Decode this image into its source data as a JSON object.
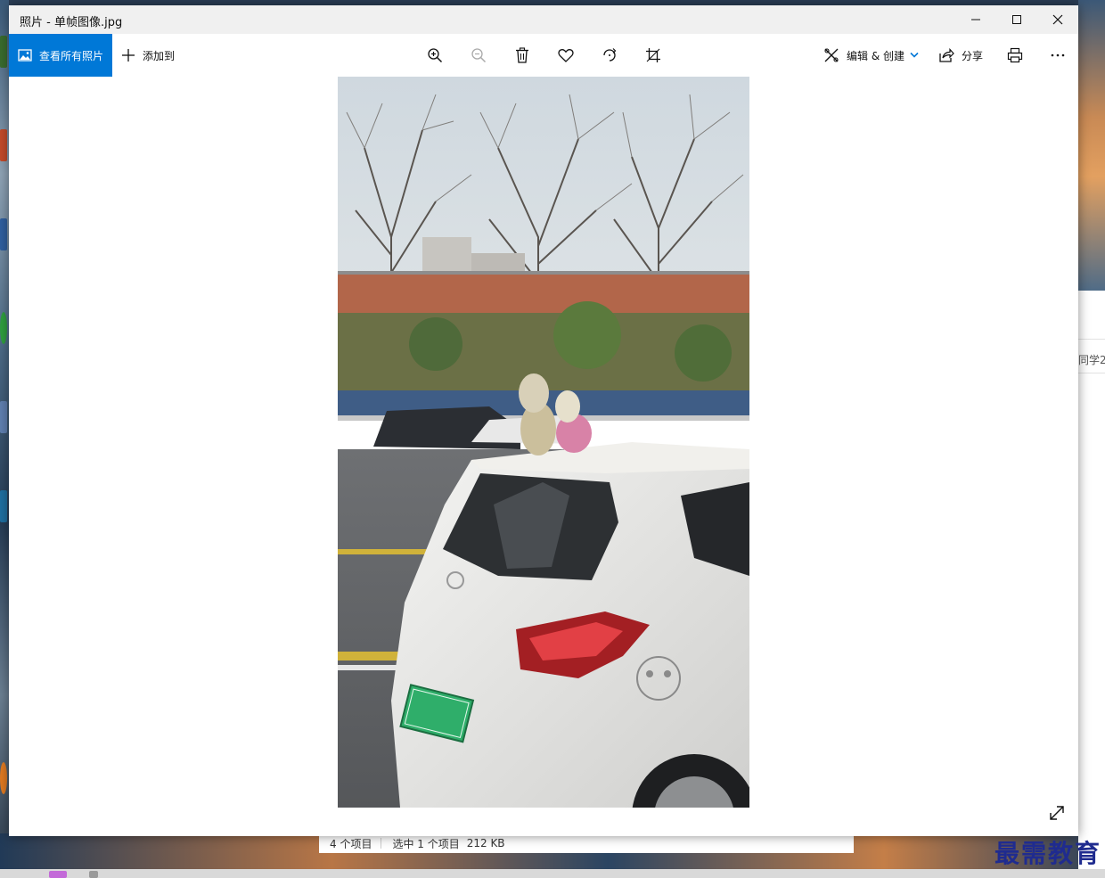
{
  "window": {
    "title": "照片 - 单帧图像.jpg"
  },
  "toolbar": {
    "view_all_label": "查看所有照片",
    "add_to_label": "添加到",
    "edit_create_label": "编辑 & 创建",
    "share_label": "分享",
    "accent_color": "#0078d7"
  },
  "icons": {
    "zoom_in": "zoom-in-icon",
    "zoom_out": "zoom-out-icon",
    "delete": "trash-icon",
    "favorite": "heart-icon",
    "rotate": "rotate-icon",
    "crop": "crop-icon",
    "print": "print-icon",
    "more": "more-icon",
    "expand": "expand-icon"
  },
  "explorer": {
    "status_items": "4 个项目",
    "status_selected": "选中 1 个项目",
    "status_size": "212 KB",
    "clipped_text": "同学2"
  },
  "watermark": {
    "text": "最需教育"
  }
}
